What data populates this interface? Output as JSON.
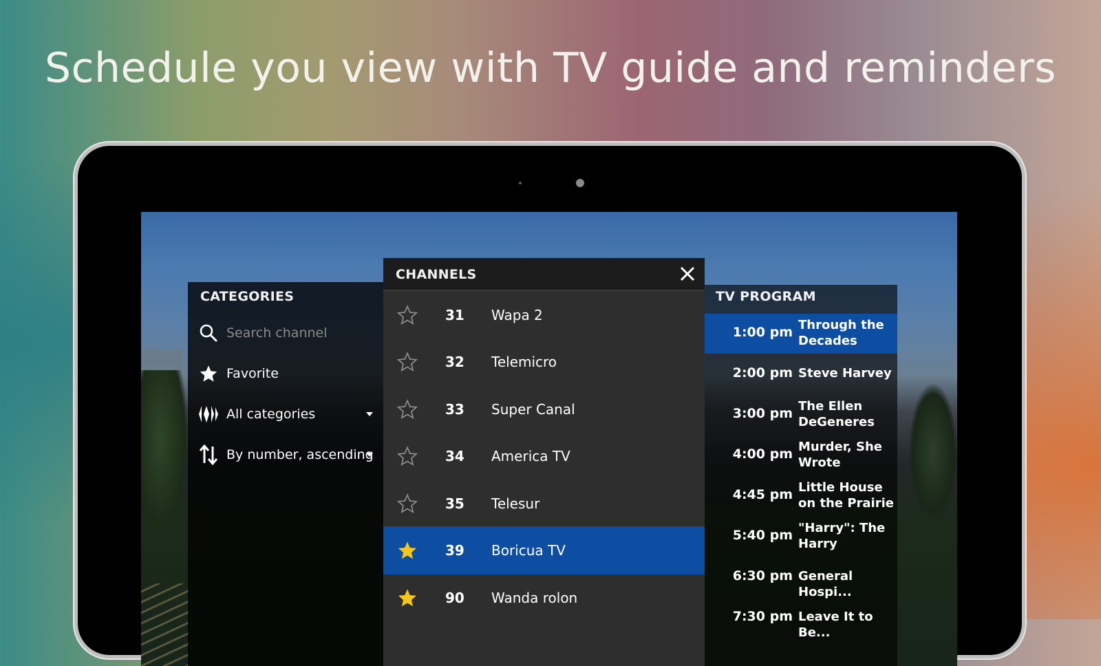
{
  "headline": "Schedule you view with TV guide and reminders",
  "categories": {
    "title": "CATEGORIES",
    "search_placeholder": "Search channel",
    "favorite_label": "Favorite",
    "all_categories_label": "All categories",
    "sort_label": "By number, ascending"
  },
  "channels": {
    "title": "CHANNELS",
    "items": [
      {
        "number": "31",
        "name": "Wapa 2",
        "favorite": false,
        "selected": false
      },
      {
        "number": "32",
        "name": "Telemicro",
        "favorite": false,
        "selected": false
      },
      {
        "number": "33",
        "name": "Super Canal",
        "favorite": false,
        "selected": false
      },
      {
        "number": "34",
        "name": "America TV",
        "favorite": false,
        "selected": false
      },
      {
        "number": "35",
        "name": "Telesur",
        "favorite": false,
        "selected": false
      },
      {
        "number": "39",
        "name": "Boricua TV",
        "favorite": true,
        "selected": true
      },
      {
        "number": "90",
        "name": "Wanda rolon",
        "favorite": true,
        "selected": false
      }
    ]
  },
  "program": {
    "title": "TV PROGRAM",
    "items": [
      {
        "time": "1:00 pm",
        "title": "Through the Decades",
        "selected": true
      },
      {
        "time": "2:00 pm",
        "title": "Steve Harvey",
        "selected": false
      },
      {
        "time": "3:00 pm",
        "title": "The Ellen DeGeneres Sh...",
        "selected": false
      },
      {
        "time": "4:00 pm",
        "title": "Murder, She Wrote",
        "selected": false
      },
      {
        "time": "4:45 pm",
        "title": "Little House on the Prairie",
        "selected": false
      },
      {
        "time": "5:40 pm",
        "title": "\"Harry\": The Harry Connick...",
        "selected": false
      },
      {
        "time": "6:30 pm",
        "title": "General Hospi...",
        "selected": false
      },
      {
        "time": "7:30 pm",
        "title": "Leave It to Be...",
        "selected": false
      }
    ]
  },
  "colors": {
    "accent": "#0d4ea3",
    "favorite_star": "#f5c518"
  }
}
